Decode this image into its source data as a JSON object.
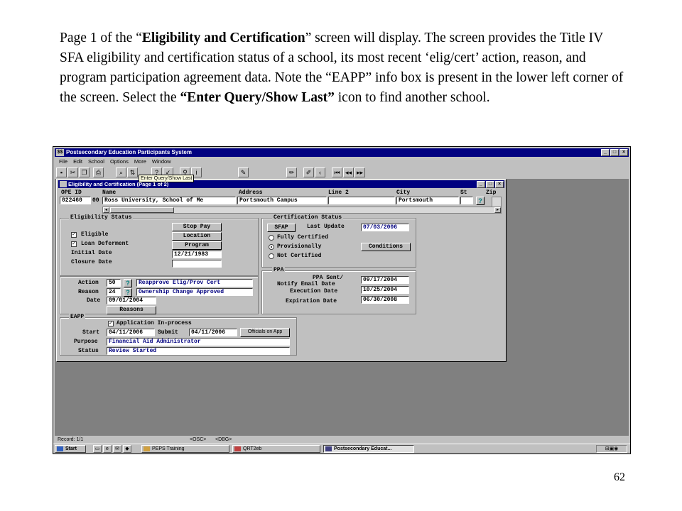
{
  "slide": {
    "p1": "Page 1 of the “",
    "b1": "Eligibility and Certification",
    "p2": "” screen will display.  The screen provides the Title IV SFA eligibility and certification status of a school, its most recent ‘elig/cert’ action, reason, and program participation agreement data.  Note the “EAPP” info box is present in the lower left corner of the screen.  Select the ",
    "b2": "“Enter Query/Show Last”",
    "p3": " icon to find another school.",
    "page_number": "62"
  },
  "app": {
    "title": "Postsecondary Education Participants System",
    "menu": [
      "File",
      "Edit",
      "School",
      "Options",
      "More",
      "Window"
    ],
    "tooltip": "Enter Query/Show Last",
    "window_buttons": [
      "_",
      "□",
      "×"
    ]
  },
  "child": {
    "title": "Eligibility and Certification (Page 1 of 2)",
    "headers": {
      "ope_id": "OPE ID",
      "name": "Name",
      "address": "Address",
      "line2": "Line 2",
      "city": "City",
      "st": "St",
      "zip": "Zip"
    },
    "values": {
      "ope_id": "022460",
      "ope_suffix": "00",
      "name": "Ross University, School of Me",
      "address": "Portsmouth Campus",
      "line2": "",
      "city": "Portsmouth",
      "st": ""
    },
    "eligibility": {
      "title": "Eligibility Status",
      "eligible": "Eligible",
      "loan_deferment": "Loan Deferment",
      "initial_date_label": "Initial Date",
      "initial_date": "12/21/1983",
      "closure_date_label": "Closure Date",
      "closure_date": "",
      "stop_pay": "Stop Pay",
      "location": "Location",
      "program": "Program"
    },
    "action": {
      "action_label": "Action",
      "action_code": "50",
      "action_desc": "Reapprove Elig/Prov Cert",
      "reason_label": "Reason",
      "reason_code": "24",
      "reason_desc": "Ownership Change Approved",
      "date_label": "Date",
      "date": "09/01/2004",
      "reasons_button": "Reasons"
    },
    "certification": {
      "title": "Certification Status",
      "sfap": "SFAP",
      "last_update_label": "Last Update",
      "last_update": "07/03/2006",
      "fully": "Fully Certified",
      "provisionally": "Provisionally",
      "not": "Not Certified",
      "conditions": "Conditions"
    },
    "ppa": {
      "title": "PPA",
      "sent_label_1": "PPA Sent/",
      "sent_label_2": "Notify Email Date",
      "sent": "09/17/2004",
      "execution_label": "Execution Date",
      "execution": "10/25/2004",
      "expiration_label": "Expiration Date",
      "expiration": "06/30/2008"
    },
    "eapp": {
      "title": "EAPP",
      "app_in_process": "Application In-process",
      "start_label": "Start",
      "start": "04/11/2006",
      "submit_label": "Submit",
      "submit": "04/11/2006",
      "officials_button": "Officials on App",
      "purpose_label": "Purpose",
      "purpose": "Financial Aid Administrator",
      "status_label": "Status",
      "status": "Review Started"
    }
  },
  "status": {
    "record": "Record: 1/1",
    "osc": "<OSC>",
    "dbg": "<DBG>"
  },
  "taskbar": {
    "start": "Start",
    "tasks": [
      "PEPS Training",
      "QRT2eb",
      "Postsecondary Educat..."
    ]
  }
}
